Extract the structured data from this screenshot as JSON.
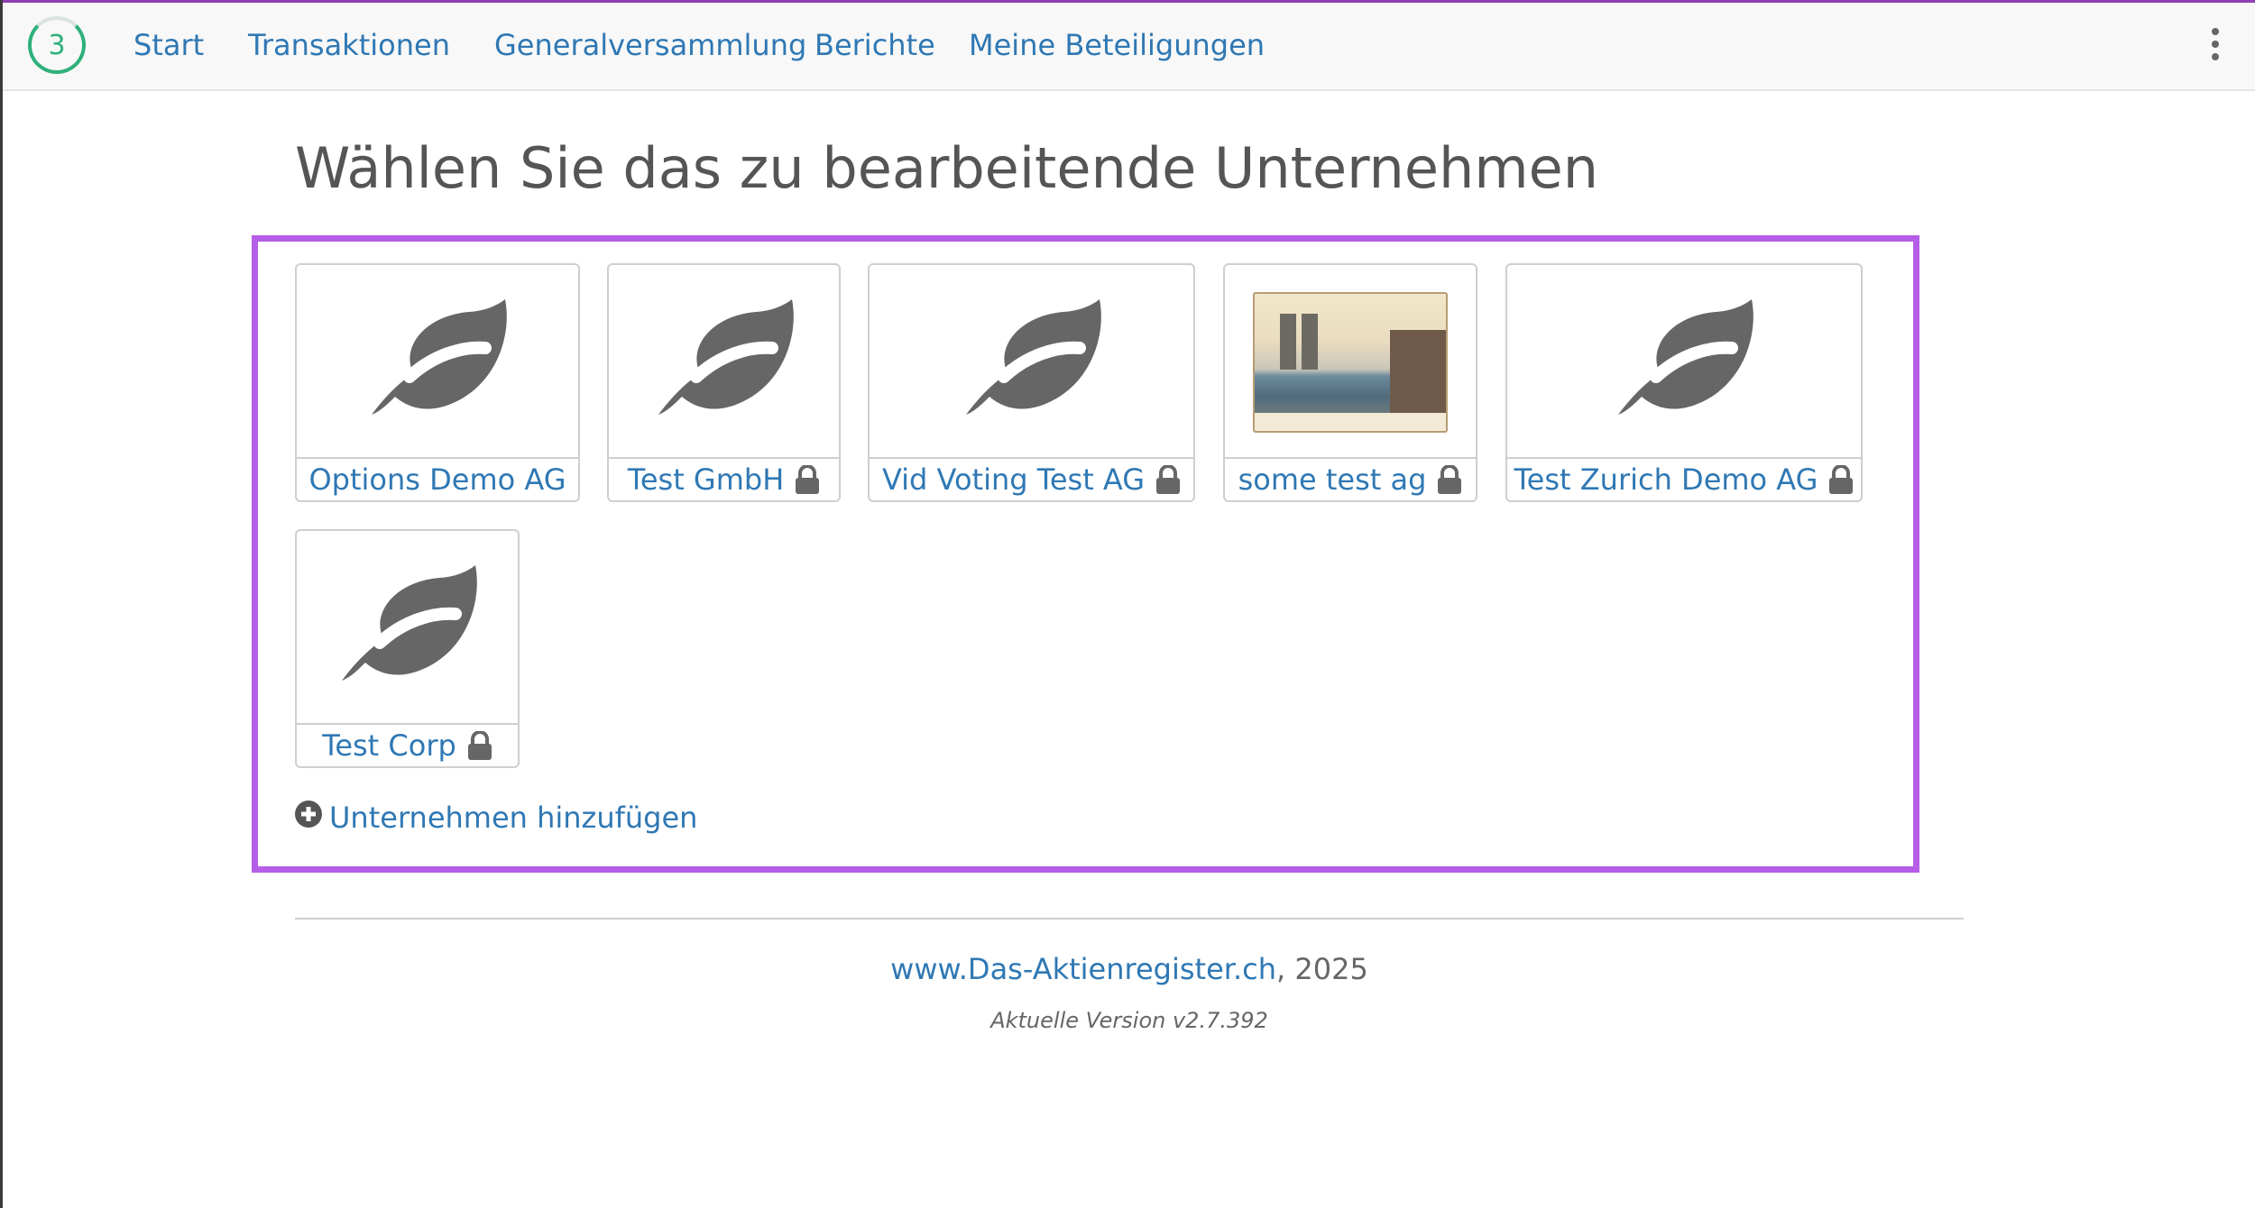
{
  "nav": {
    "logo_number": "3",
    "links": [
      {
        "label": "Start"
      },
      {
        "label": "Transaktionen"
      },
      {
        "label": "Generalversammlung"
      },
      {
        "label": "Berichte"
      },
      {
        "label": "Meine Beteiligungen"
      }
    ],
    "menu_icon": "more-vertical-icon"
  },
  "page": {
    "title": "Wählen Sie das zu bearbeitende Unternehmen"
  },
  "companies": [
    {
      "name": "Options Demo AG",
      "locked": false,
      "thumbnail": "leaf-icon"
    },
    {
      "name": "Test GmbH",
      "locked": true,
      "thumbnail": "leaf-icon"
    },
    {
      "name": "Vid Voting Test AG",
      "locked": true,
      "thumbnail": "leaf-icon"
    },
    {
      "name": "some test ag",
      "locked": true,
      "thumbnail": "painting-image"
    },
    {
      "name": "Test Zurich Demo AG",
      "locked": true,
      "thumbnail": "leaf-icon"
    },
    {
      "name": "Test Corp",
      "locked": true,
      "thumbnail": "leaf-icon"
    }
  ],
  "add_company": {
    "label": "Unternehmen hinzufügen",
    "icon": "plus-circle-icon"
  },
  "footer": {
    "site_link": "www.Das-Aktienregister.ch",
    "year_suffix": ", 2025",
    "version": "Aktuelle Version v2.7.392"
  },
  "colors": {
    "accent": "#2f78b4",
    "selection_border": "#b55ee8",
    "logo_green": "#2fb07a",
    "icon_gray": "#666666"
  }
}
